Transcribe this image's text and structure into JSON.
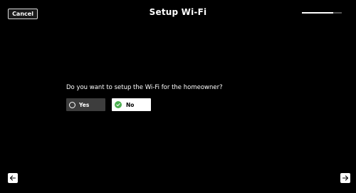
{
  "header": {
    "cancel_label": "Cancel",
    "title": "Setup Wi-Fi",
    "progress_fraction": 0.78
  },
  "main": {
    "question": "Do you want to setup the Wi-Fi for the homeowner?",
    "options": [
      {
        "label": "Yes",
        "selected": false
      },
      {
        "label": "No",
        "selected": true
      }
    ]
  },
  "footer": {
    "back_icon": "arrow-left-icon",
    "next_icon": "arrow-right-icon"
  },
  "colors": {
    "background": "#000000",
    "selected_check": "#4caf50",
    "unselected_option_bg": "#3d3d3d"
  }
}
